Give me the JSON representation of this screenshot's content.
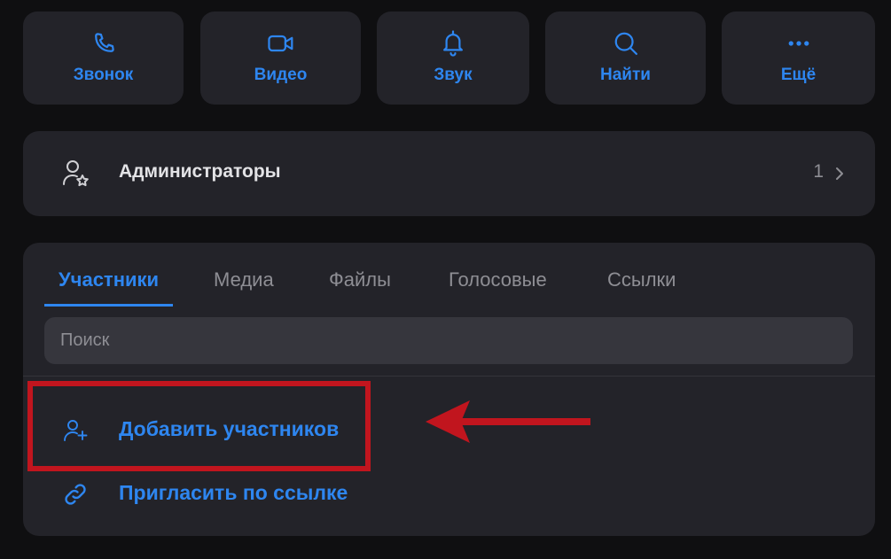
{
  "actions": [
    {
      "label": "Звонок",
      "icon": "phone-icon"
    },
    {
      "label": "Видео",
      "icon": "video-icon"
    },
    {
      "label": "Звук",
      "icon": "bell-icon"
    },
    {
      "label": "Найти",
      "icon": "search-icon"
    },
    {
      "label": "Ещё",
      "icon": "more-dots-icon"
    }
  ],
  "admins": {
    "title": "Администраторы",
    "count": "1",
    "icon": "user-star-icon"
  },
  "tabs": [
    {
      "label": "Участники",
      "active": true
    },
    {
      "label": "Медиа",
      "active": false
    },
    {
      "label": "Файлы",
      "active": false
    },
    {
      "label": "Голосовые",
      "active": false
    },
    {
      "label": "Ссылки",
      "active": false
    }
  ],
  "search": {
    "placeholder": "Поиск",
    "value": ""
  },
  "member_actions": {
    "add_members": "Добавить участников",
    "invite_link": "Пригласить по ссылке"
  },
  "colors": {
    "accent": "#2e86f0",
    "background": "#0f0f11",
    "card": "#232329",
    "annotation": "#c1151e"
  }
}
